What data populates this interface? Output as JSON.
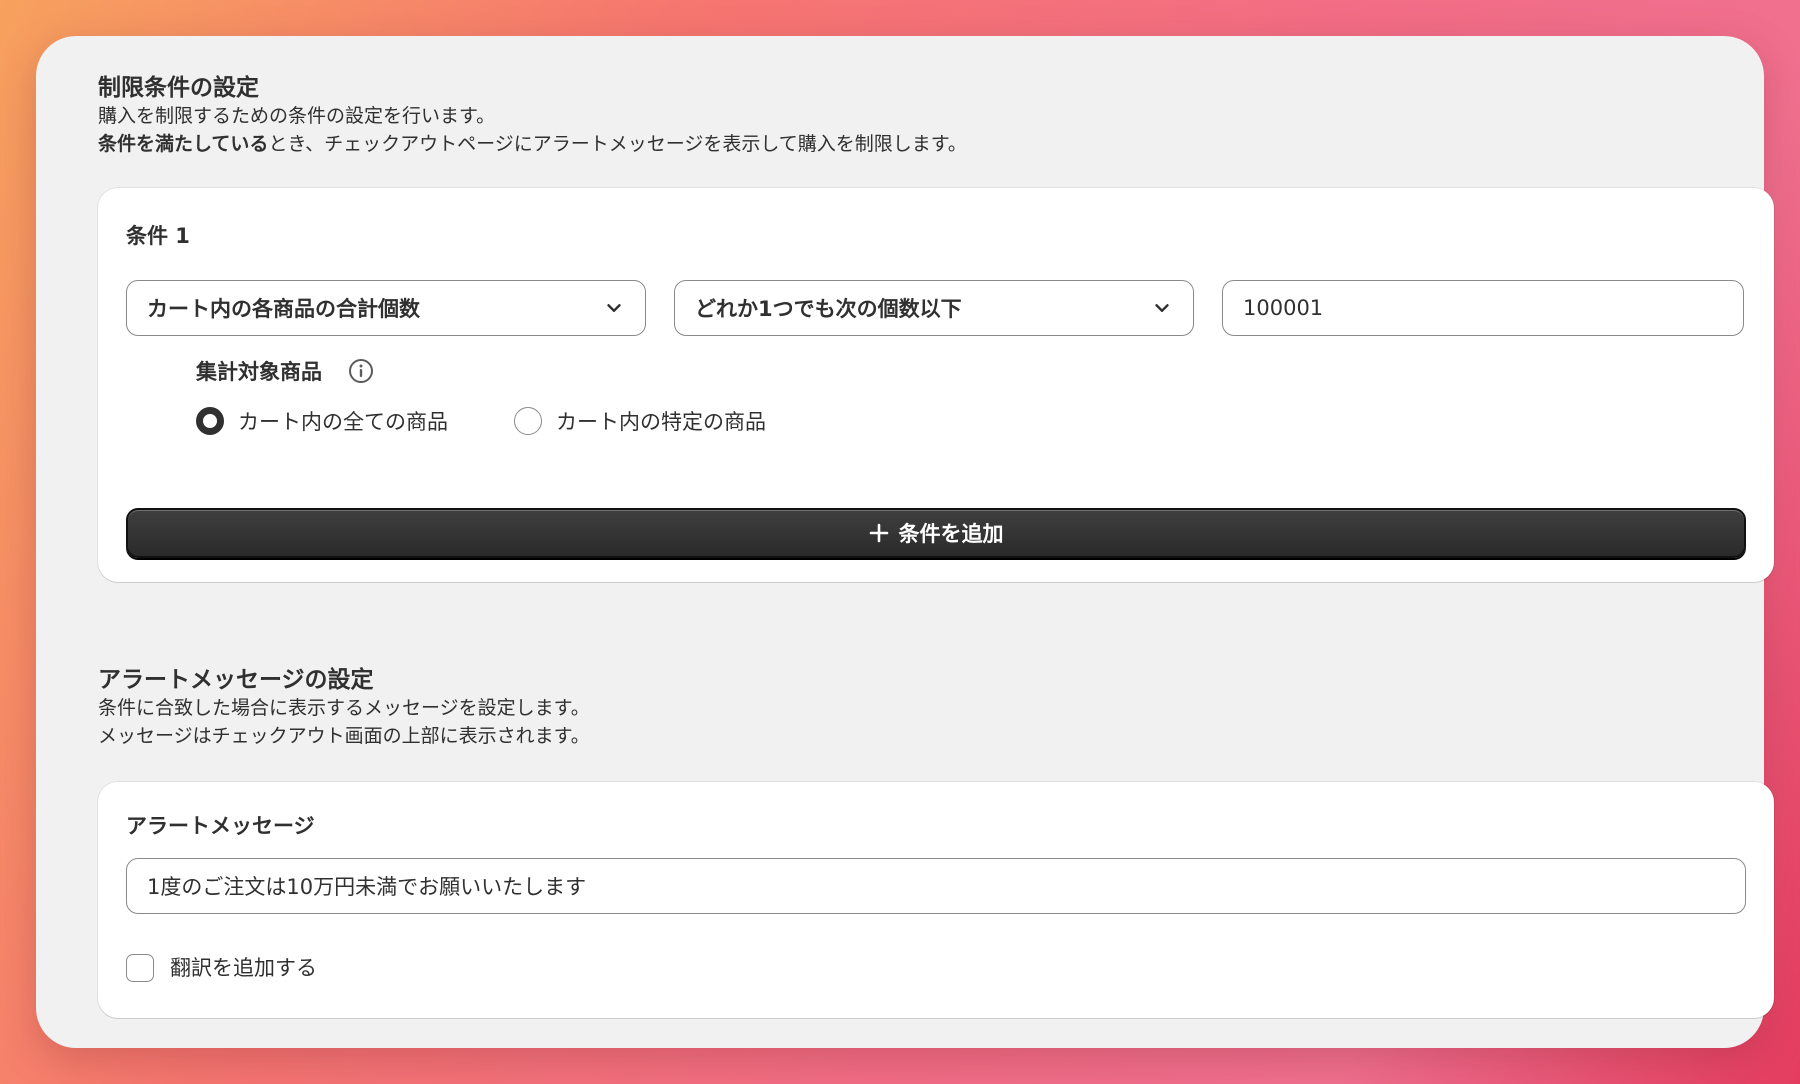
{
  "restriction": {
    "title": "制限条件の設定",
    "desc_line1": "購入を制限するための条件の設定を行います。",
    "desc_line2_bold": "条件を満たしている",
    "desc_line2_rest": "とき、チェックアウトページにアラートメッセージを表示して購入を制限します。",
    "condition_label": "条件 1",
    "field_select": "カート内の各商品の合計個数",
    "operator_select": "どれか1つでも次の個数以下",
    "value_input": "100001",
    "target_label": "集計対象商品",
    "radio_all": "カート内の全ての商品",
    "radio_specific": "カート内の特定の商品",
    "selected_radio": "all",
    "add_button": "条件を追加"
  },
  "alert": {
    "title": "アラートメッセージの設定",
    "desc_line1": "条件に合致した場合に表示するメッセージを設定します。",
    "desc_line2": "メッセージはチェックアウト画面の上部に表示されます。",
    "message_label": "アラートメッセージ",
    "message_value": "1度のご注文は10万円未満でお願いいたします",
    "translation_checkbox": "翻訳を追加する",
    "translation_checked": false
  },
  "icons": {
    "select_chevron": "chevron-down-icon",
    "info": "info-icon",
    "plus": "plus-icon"
  },
  "colors": {
    "panel_bg": "#f1f1f1",
    "button_bg": "#303030",
    "text": "#303030"
  }
}
